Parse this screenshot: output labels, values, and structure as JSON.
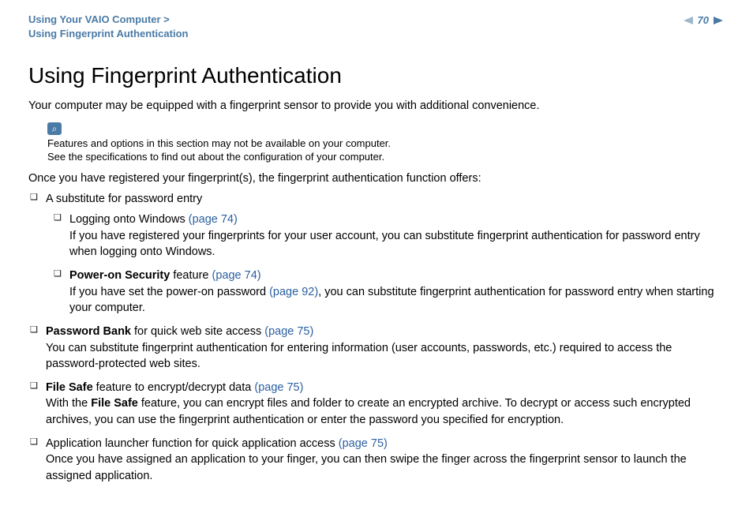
{
  "header": {
    "breadcrumb_line1": "Using Your VAIO Computer >",
    "breadcrumb_line2": "Using Fingerprint Authentication",
    "page_number": "70"
  },
  "title": "Using Fingerprint Authentication",
  "intro": "Your computer may be equipped with a fingerprint sensor to provide you with additional convenience.",
  "info": {
    "line1": "Features and options in this section may not be available on your computer.",
    "line2": "See the specifications to find out about the configuration of your computer."
  },
  "lead": "Once you have registered your fingerprint(s), the fingerprint authentication function offers:",
  "items": [
    {
      "title": "A substitute for password entry",
      "children": [
        {
          "prefix": "Logging onto Windows ",
          "link": "(page 74)",
          "body": "If you have registered your fingerprints for your user account, you can substitute fingerprint authentication for password entry when logging onto Windows."
        },
        {
          "bold_prefix": "Power-on Security",
          "prefix_rest": " feature ",
          "link": "(page 74)",
          "body_pre": "If you have set the power-on password ",
          "body_link": "(page 92)",
          "body_post": ", you can substitute fingerprint authentication for password entry when starting your computer."
        }
      ]
    },
    {
      "bold_prefix": "Password Bank",
      "prefix_rest": " for quick web site access ",
      "link": "(page 75)",
      "body": "You can substitute fingerprint authentication for entering information (user accounts, passwords, etc.) required to access the password-protected web sites."
    },
    {
      "bold_prefix": "File Safe",
      "prefix_rest": " feature to encrypt/decrypt data ",
      "link": "(page 75)",
      "body_pre": "With the ",
      "body_bold": "File Safe",
      "body_post": " feature, you can encrypt files and folder to create an encrypted archive. To decrypt or access such encrypted archives, you can use the fingerprint authentication or enter the password you specified for encryption."
    },
    {
      "prefix": "Application launcher function for quick application access ",
      "link": "(page 75)",
      "body": "Once you have assigned an application to your finger, you can then swipe the finger across the fingerprint sensor to launch the assigned application."
    }
  ]
}
